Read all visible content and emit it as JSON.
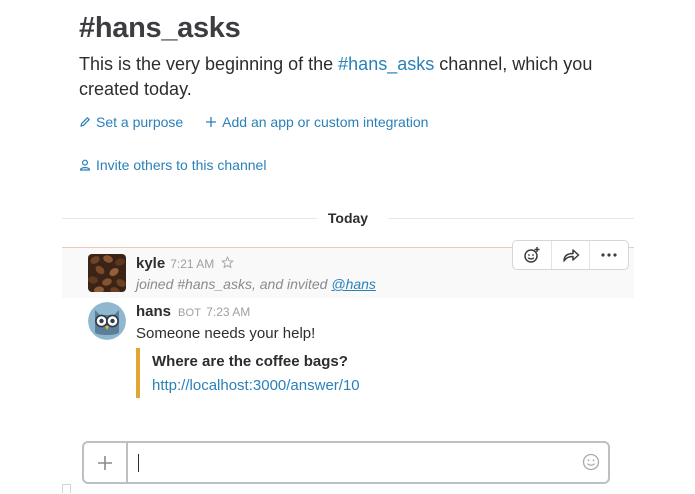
{
  "channel": {
    "title": "#hans_asks",
    "intro_prefix": "This is the very beginning of the ",
    "intro_channel": "#hans_asks",
    "intro_suffix": " channel, which you created today."
  },
  "actions": {
    "set_purpose": "Set a purpose",
    "add_integration": "Add an app or custom integration",
    "invite": "Invite others to this channel"
  },
  "day_divider": "Today",
  "messages": [
    {
      "sender": "kyle",
      "time": "7:21 AM",
      "joined_prefix": "joined #hans_asks, and invited ",
      "joined_mention": "@hans"
    },
    {
      "sender": "hans",
      "badge": "BOT",
      "time": "7:23 AM",
      "text": "Someone needs your help!",
      "attachment": {
        "title": "Where are the coffee bags?",
        "link": "http://localhost:3000/answer/10",
        "color": "#e0a532"
      }
    }
  ],
  "composer": {
    "value": "",
    "placeholder": ""
  },
  "colors": {
    "link": "#2a80b9",
    "attachment_bar": "#e0a532"
  },
  "icons": {
    "set_purpose": "pencil-icon",
    "add_integration": "plus-icon",
    "invite": "person-icon",
    "star": "star-icon",
    "reaction": "add-reaction-icon",
    "share": "share-icon",
    "more": "more-icon",
    "attach": "plus-icon",
    "emoji": "emoji-icon"
  }
}
